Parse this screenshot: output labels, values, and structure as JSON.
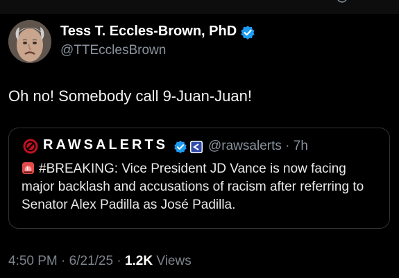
{
  "tweet": {
    "author_name": "Tess T. Eccles-Brown, PhD",
    "author_handle": "@TTEcclesBrown",
    "text": "Oh no! Somebody call 9-Juan-Juan!",
    "time": "4:50 PM",
    "date": "6/21/25",
    "views_count": "1.2K",
    "views_label": "Views",
    "separator": "·"
  },
  "quote": {
    "author_name": "RAWSALERTS",
    "handle_time": "@rawsalerts · 7h",
    "body": "#BREAKING: Vice President JD Vance is now facing major backlash and accusations of racism after referring to Senator Alex Padilla as José Padilla."
  },
  "icons": {
    "verified": "verified-badge-icon",
    "affiliate": "affiliate-badge-icon",
    "siren": "siren-emoji",
    "quote_avatar": "rawsalerts-logo"
  },
  "colors": {
    "background": "#000000",
    "verified_blue": "#1d9bf0",
    "muted_text": "#8b949e",
    "border": "#2f3336"
  }
}
